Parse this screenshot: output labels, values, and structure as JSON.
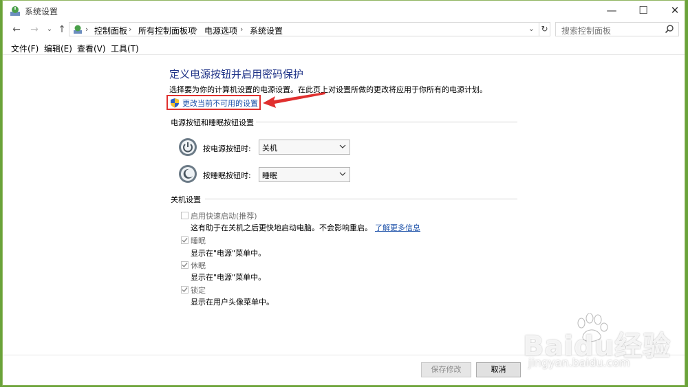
{
  "window": {
    "title": "系统设置",
    "minimize": "—",
    "maximize": "☐",
    "close": "✕"
  },
  "address": {
    "crumbs": [
      "控制面板",
      "所有控制面板项",
      "电源选项",
      "系统设置"
    ],
    "separator": "›",
    "search_placeholder": "搜索控制面板"
  },
  "menu": [
    "文件(F)",
    "编辑(E)",
    "查看(V)",
    "工具(T)"
  ],
  "main": {
    "heading": "定义电源按钮并启用密码保护",
    "description": "选择要为你的计算机设置的电源设置。在此页上对设置所做的更改将应用于你所有的电源计划。",
    "change_link": "更改当前不可用的设置",
    "power_section": {
      "title": "电源按钮和睡眠按钮设置",
      "rows": [
        {
          "label": "按电源按钮时:",
          "value": "关机",
          "icon": "power-icon"
        },
        {
          "label": "按睡眠按钮时:",
          "value": "睡眠",
          "icon": "sleep-icon"
        }
      ]
    },
    "shutdown_section": {
      "title": "关机设置",
      "items": [
        {
          "label": "启用快速启动(推荐)",
          "desc": "这有助于在关机之后更快地启动电脑。不会影响重启。",
          "link": "了解更多信息",
          "checked": false
        },
        {
          "label": "睡眠",
          "desc": "显示在\"电源\"菜单中。",
          "checked": true
        },
        {
          "label": "休眠",
          "desc": "显示在\"电源\"菜单中。",
          "checked": true
        },
        {
          "label": "锁定",
          "desc": "显示在用户头像菜单中。",
          "checked": true
        }
      ]
    }
  },
  "buttons": {
    "save": "保存修改",
    "cancel": "取消"
  },
  "watermark": {
    "main": "Baidu经验",
    "sub": "jingyan.baidu.com"
  },
  "colors": {
    "heading": "#1e3287",
    "link": "#1a4fa8",
    "highlight": "#e0302f",
    "desktop": "#6aa33a"
  }
}
